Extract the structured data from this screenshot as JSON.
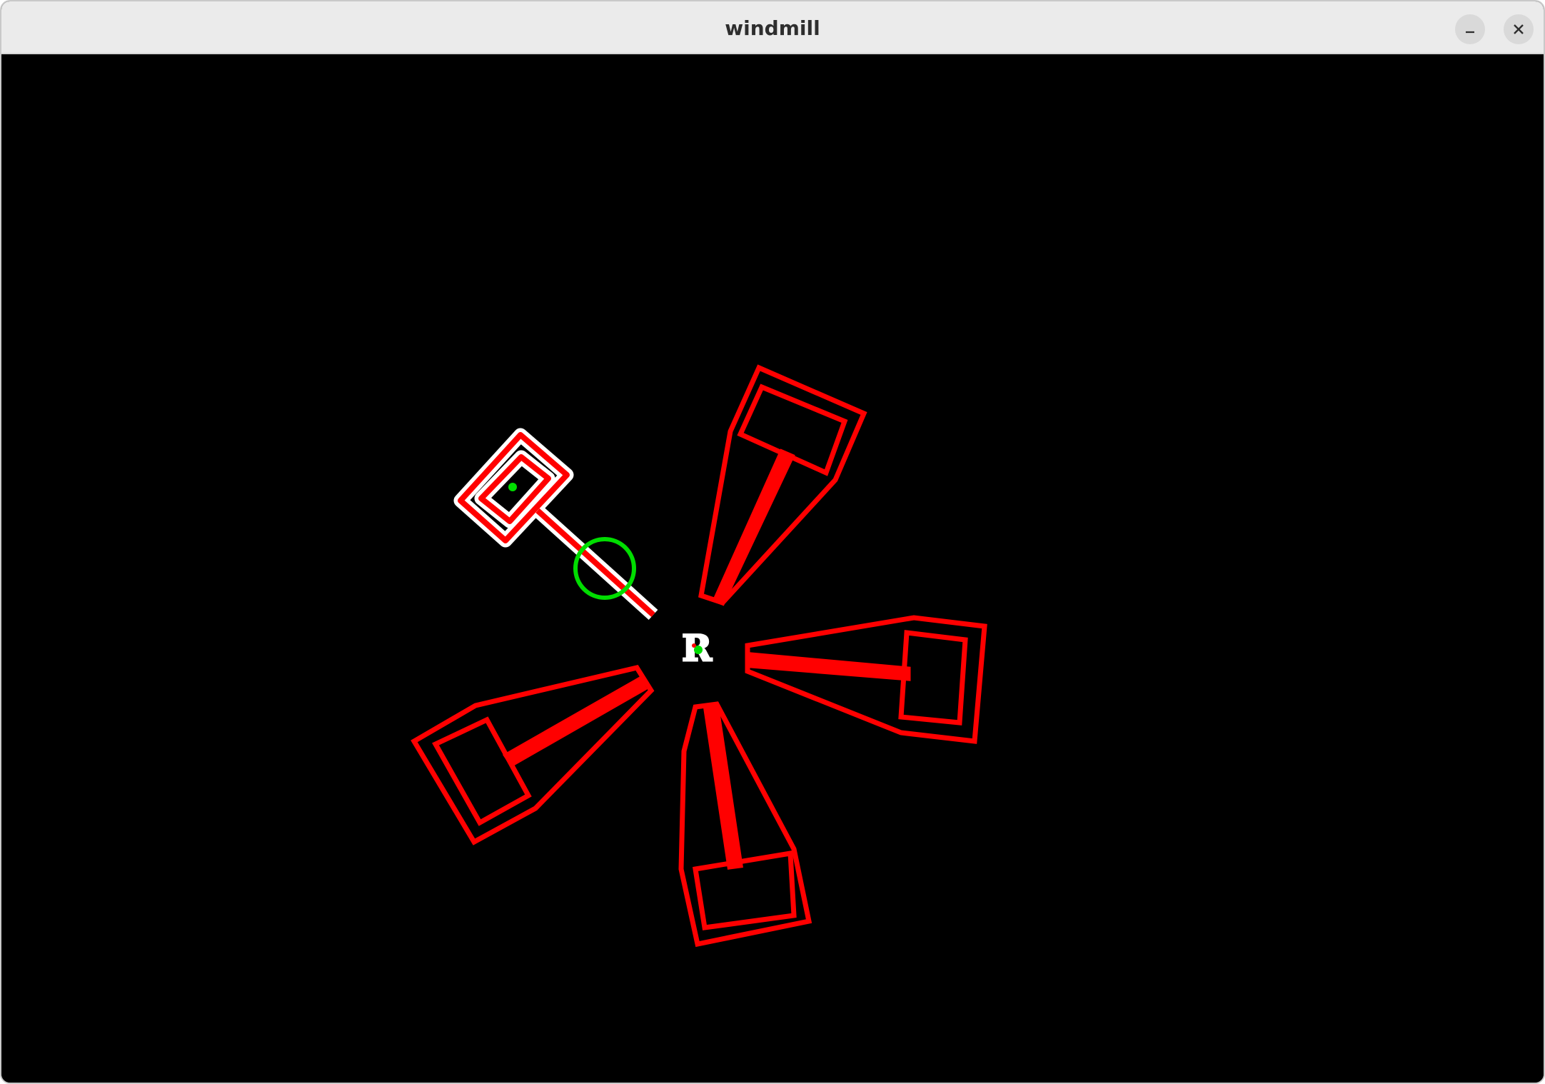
{
  "window": {
    "title": "windmill",
    "minimize_icon": "minimize-icon",
    "close_icon": "close-icon"
  },
  "scene": {
    "background_color": "#000000",
    "blade_color": "#ff0000",
    "highlight_color": "#ffffff",
    "marker_color": "#00dd00",
    "center_label": "R"
  }
}
